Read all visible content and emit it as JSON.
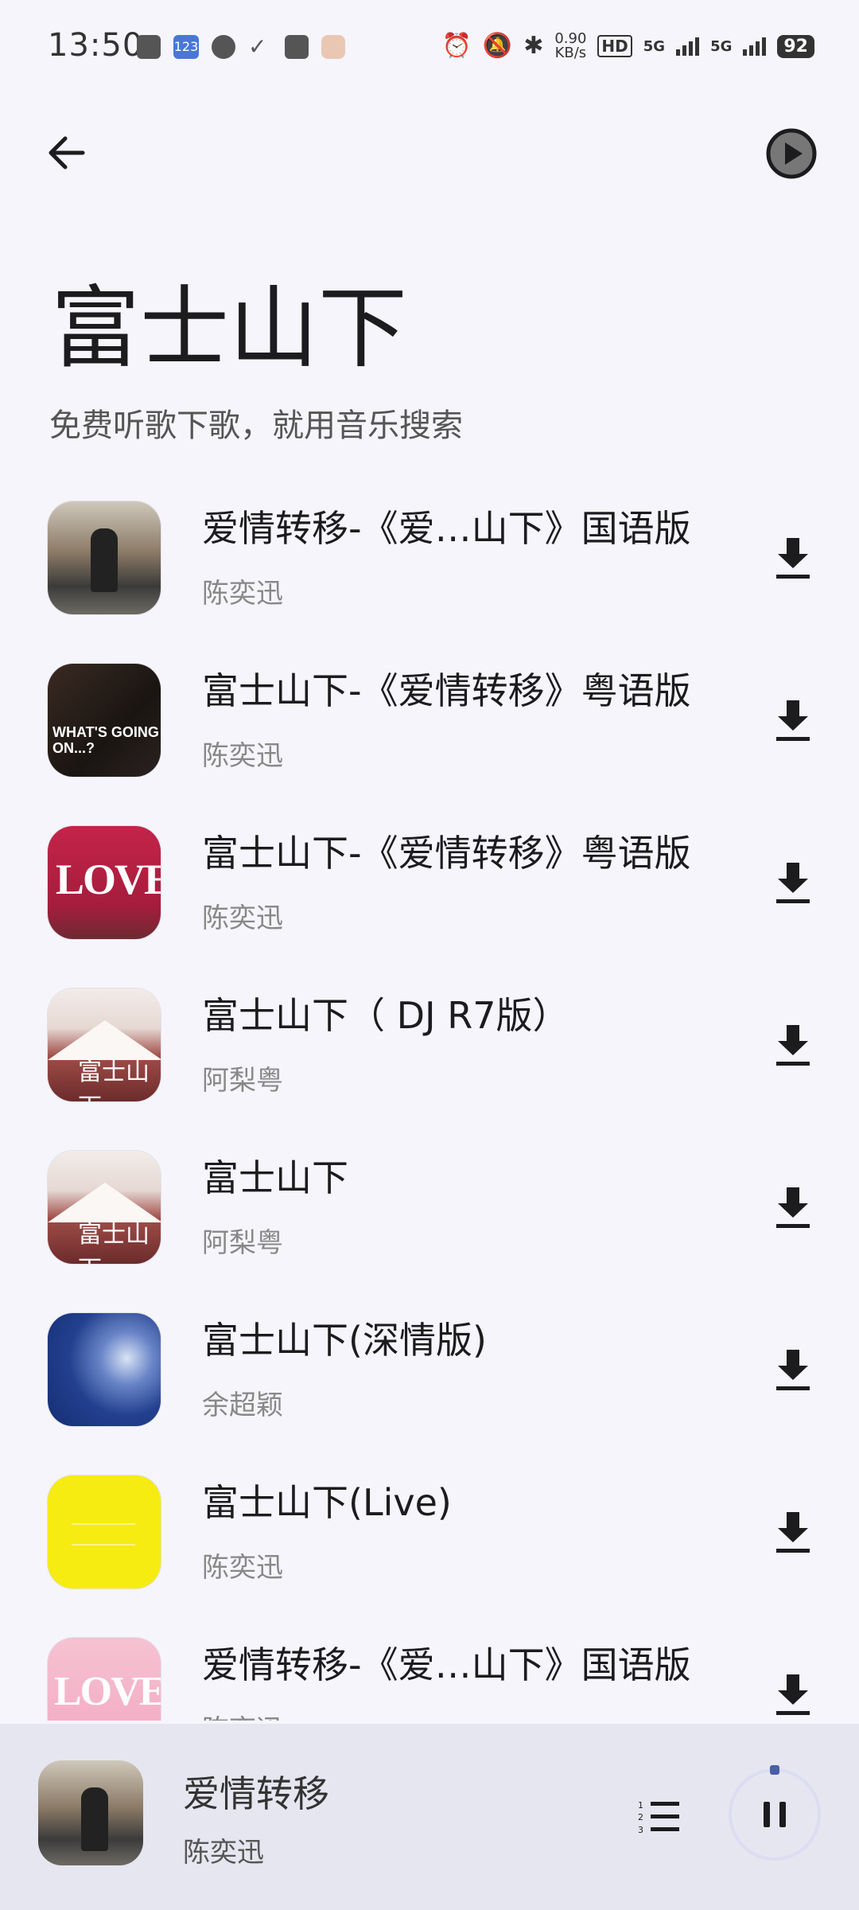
{
  "status_bar": {
    "time": "13:50",
    "notif_badge": "123",
    "speed_value": "0.90",
    "speed_unit": "KB/s",
    "hd_label": "HD",
    "sim1": "5G",
    "sim2": "5G",
    "battery": "92"
  },
  "header": {
    "title": "富士山下",
    "subtitle": "免费听歌下歌，就用音乐搜索"
  },
  "songs": [
    {
      "title": "爱情转移-《爱…山下》国语版",
      "artist": "陈奕迅",
      "cover": "jacket"
    },
    {
      "title": "富士山下-《爱情转移》粤语版",
      "artist": "陈奕迅",
      "cover": "night",
      "cover_text": "WHAT'S GOING ON...?"
    },
    {
      "title": "富士山下-《爱情转移》粤语版",
      "artist": "陈奕迅",
      "cover": "love",
      "cover_text": "LOVE"
    },
    {
      "title": "富士山下（ DJ R7版）",
      "artist": "阿梨粤",
      "cover": "fuji",
      "cover_text": "富士山下"
    },
    {
      "title": "富士山下",
      "artist": "阿梨粤",
      "cover": "fuji",
      "cover_text": "富士山下"
    },
    {
      "title": "富士山下(深情版)",
      "artist": "余超颖",
      "cover": "blue"
    },
    {
      "title": "富士山下(Live)",
      "artist": "陈奕迅",
      "cover": "yellow"
    },
    {
      "title": "爱情转移-《爱…山下》国语版",
      "artist": "陈奕迅",
      "cover": "pink",
      "cover_text": "LOVE"
    }
  ],
  "player": {
    "title": "爱情转移",
    "artist": "陈奕迅"
  },
  "colors": {
    "background": "#f5f5fb",
    "player_bar": "#e6e6f0",
    "icon": "#1c1c1e"
  }
}
